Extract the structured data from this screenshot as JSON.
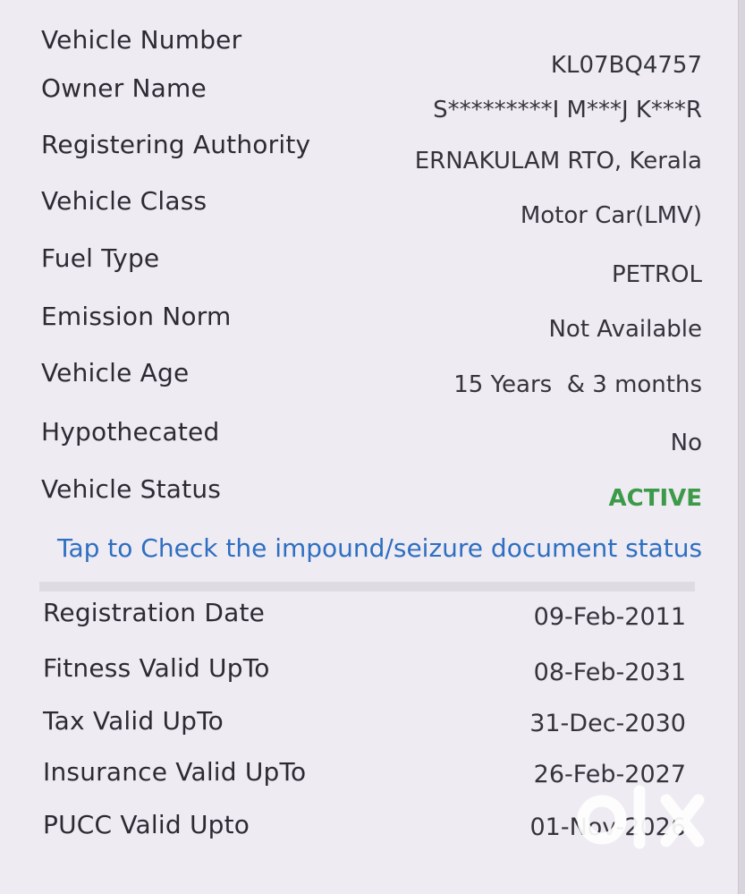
{
  "details": [
    {
      "label": "Vehicle Number",
      "value": "KL07BQ4757"
    },
    {
      "label": "Owner Name",
      "value": "S*********I M***J K***R"
    },
    {
      "label": "Registering Authority",
      "value": "ERNAKULAM RTO, Kerala"
    },
    {
      "label": "Vehicle Class",
      "value": "Motor Car(LMV)"
    },
    {
      "label": "Fuel Type",
      "value": "PETROL"
    },
    {
      "label": "Emission Norm",
      "value": "Not Available"
    },
    {
      "label": "Vehicle Age",
      "value": "15 Years  & 3 months"
    },
    {
      "label": "Hypothecated",
      "value": "No"
    },
    {
      "label": "Vehicle Status",
      "value": "ACTIVE"
    }
  ],
  "link_text": "Tap to Check the impound/seizure document status",
  "validity": [
    {
      "label": "Registration Date",
      "value": "09-Feb-2011"
    },
    {
      "label": "Fitness Valid UpTo",
      "value": "08-Feb-2031"
    },
    {
      "label": "Tax Valid UpTo",
      "value": "31-Dec-2030"
    },
    {
      "label": "Insurance Valid UpTo",
      "value": "26-Feb-2027"
    },
    {
      "label": "PUCC Valid Upto",
      "value": "01-Nov-2026"
    }
  ],
  "watermark": "OLX",
  "colors": {
    "status_active": "#3c9a49",
    "link": "#2e6fc1"
  }
}
